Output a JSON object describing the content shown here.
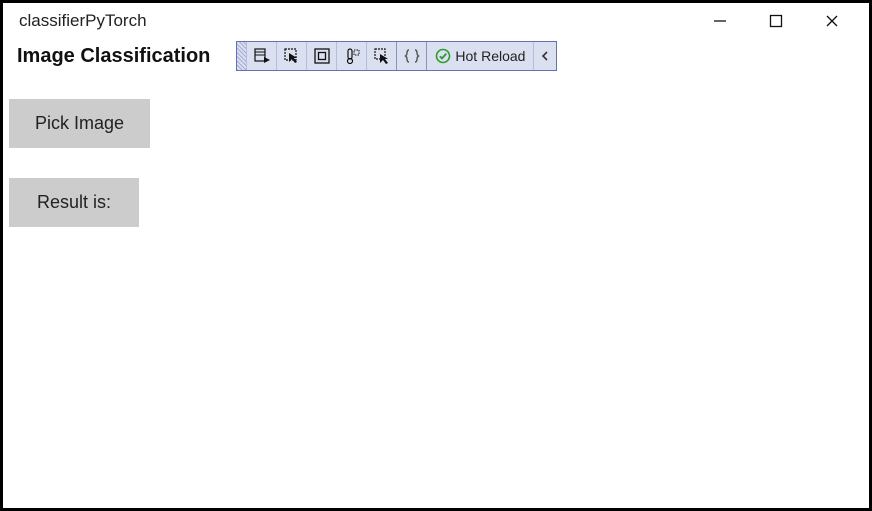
{
  "window": {
    "title": "classifierPyTorch"
  },
  "header": {
    "page_title": "Image Classification"
  },
  "toolbar": {
    "hot_reload_label": "Hot Reload"
  },
  "content": {
    "pick_button_label": "Pick Image",
    "result_label": "Result is:"
  }
}
